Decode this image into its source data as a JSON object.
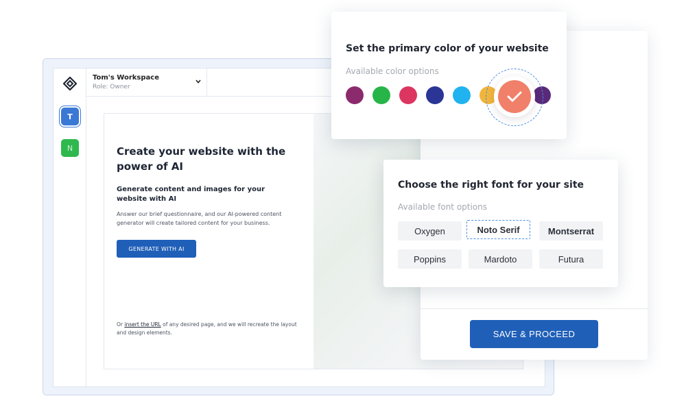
{
  "workspace": {
    "name": "Tom's Workspace",
    "role": "Role: Owner"
  },
  "rail": {
    "avatars": [
      "T",
      "N"
    ]
  },
  "hero": {
    "title": "Create your website with the power of AI",
    "subtitle": "Generate content and images for your website with AI",
    "description": "Answer our brief questionnaire, and our AI-powered content generator will create tailored content for your business.",
    "generate_label": "GENERATE WITH AI",
    "url_note_prefix": "Or ",
    "url_note_link": "insert the URL",
    "url_note_suffix": " of any desired page, and we will recreate the layout and design elements."
  },
  "color_panel": {
    "title": "Set the primary color of your website",
    "subtitle": "Available color options",
    "swatches": [
      "#8c2a6e",
      "#27b548",
      "#dc3560",
      "#2a3595",
      "#20b3ef",
      "#f2b53c",
      "#f0806a",
      "#5a2a7a"
    ],
    "selected_color": "#f0806a"
  },
  "font_panel": {
    "title": "Choose the right font for your site",
    "subtitle": "Available font options",
    "options": [
      "Oxygen",
      "Noto Serif",
      "Montserrat",
      "Poppins",
      "Mardoto",
      "Futura"
    ],
    "selected": "Noto Serif"
  },
  "actions": {
    "save_label": "SAVE & PROCEED"
  }
}
